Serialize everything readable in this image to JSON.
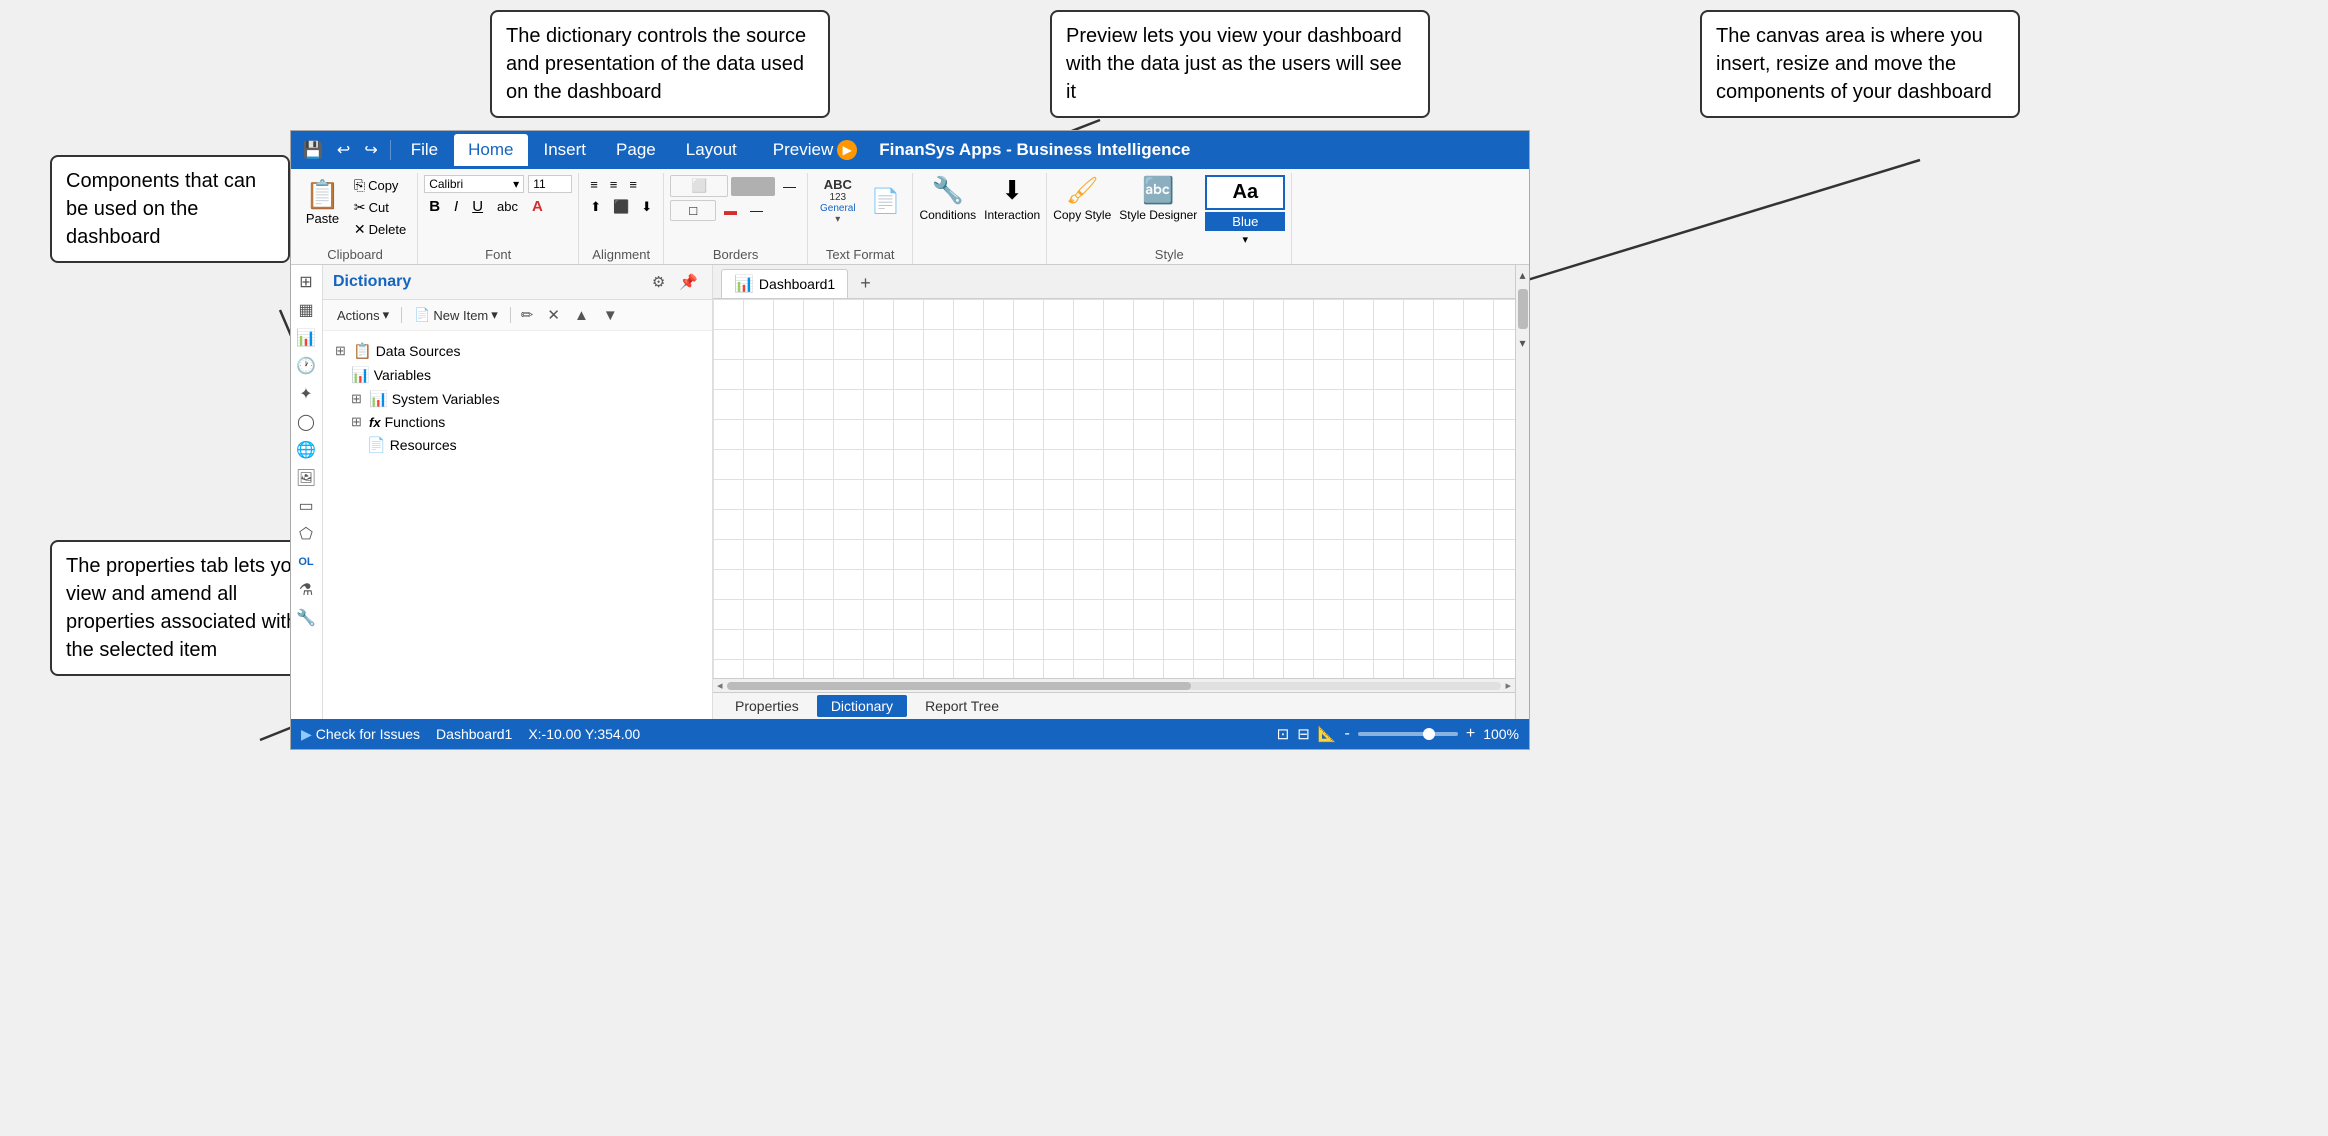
{
  "callouts": {
    "components": "Components that can be used on the dashboard",
    "dictionary": "The dictionary controls the source and presentation of the data used on the dashboard",
    "preview": "Preview lets you view your dashboard with the data just as the users will see it",
    "canvas": "The canvas area is where you insert, resize and move the components of your dashboard",
    "properties": "The properties tab lets you view and amend all properties associated with the selected item"
  },
  "ribbon": {
    "tabs": [
      "File",
      "Home",
      "Insert",
      "Page",
      "Layout"
    ],
    "active_tab": "Home",
    "preview_label": "Preview",
    "app_title": "FinanSys Apps - Business Intelligence",
    "groups": {
      "clipboard": {
        "label": "Clipboard",
        "paste": "Paste",
        "copy": "Copy",
        "cut": "Cut",
        "delete": "Delete"
      },
      "font": {
        "label": "Font",
        "font_name": "Calibri",
        "font_size": "11",
        "bold": "B",
        "italic": "I",
        "underline": "U"
      },
      "alignment": {
        "label": "Alignment"
      },
      "borders": {
        "label": "Borders"
      },
      "text_format": {
        "label": "Text Format"
      },
      "style": {
        "label": "Style",
        "conditions": "Conditions",
        "interaction": "Interaction",
        "copy_style": "Copy Style",
        "style_designer": "Style Designer",
        "preview_text": "Aa",
        "blue_label": "Blue"
      }
    }
  },
  "dictionary_panel": {
    "title": "Dictionary",
    "actions_btn": "Actions",
    "new_item_btn": "New Item",
    "tree_items": [
      {
        "label": "Data Sources",
        "level": 0,
        "expanded": true,
        "icon": "📋"
      },
      {
        "label": "Variables",
        "level": 1,
        "icon": "📊"
      },
      {
        "label": "System Variables",
        "level": 1,
        "expanded": true,
        "icon": "📊"
      },
      {
        "label": "Functions",
        "level": 1,
        "expanded": true,
        "icon": "fx"
      },
      {
        "label": "Resources",
        "level": 2,
        "icon": "📄"
      }
    ]
  },
  "canvas": {
    "tab_label": "Dashboard1",
    "add_tab_icon": "+"
  },
  "bottom_tabs": {
    "properties": "Properties",
    "dictionary": "Dictionary",
    "active": "Dictionary",
    "report_tree": "Report Tree"
  },
  "status_bar": {
    "check_issues": "Check for Issues",
    "dashboard": "Dashboard1",
    "coordinates": "X:-10.00 Y:354.00",
    "zoom": "100%",
    "zoom_minus": "-",
    "zoom_plus": "+"
  }
}
